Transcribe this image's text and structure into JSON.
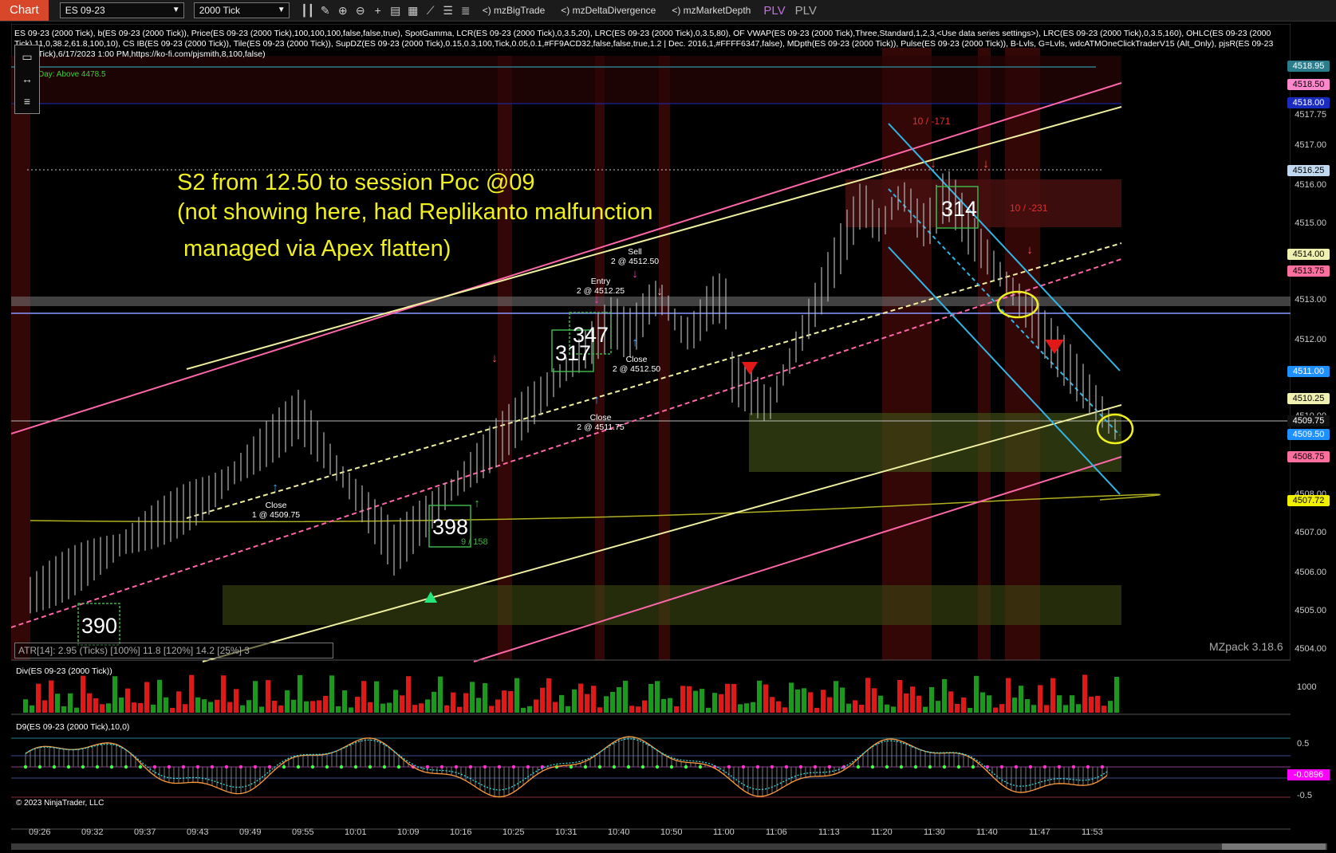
{
  "toolbar": {
    "chart_tab": "Chart",
    "instrument": "ES 09-23",
    "interval": "2000 Tick",
    "links": [
      "<) mzBigTrade",
      "<) mzDeltaDivergence",
      "<) mzMarketDepth"
    ],
    "plv_a": "PLV",
    "plv_b": "PLV"
  },
  "indicator_header": "ES 09-23 (2000 Tick), b(ES 09-23 (2000 Tick)), Price(ES 09-23 (2000 Tick),100,100,100,false,false,true), SpotGamma, LCR(ES 09-23 (2000 Tick),0,3.5,20), LRC(ES 09-23 (2000 Tick),0,3.5,80), OF VWAP(ES 09-23 (2000 Tick),Three,Standard,1,2,3,<Use data series settings>), LRC(ES 09-23 (2000 Tick),0,3.5,160), OHLC(ES 09-23 (2000 Tick),11,0,38.2,61.8,100,10), CS IB(ES 09-23 (2000 Tick)), Tile(ES 09-23 (2000 Tick)), SupDZ(ES 09-23 (2000 Tick),0.15,0.3,100,Tick,0.05,0.1,#FF9ACD32,false,false,true,1.2 | Dec. 2016,1,#FFFF6347,false), MDpth(ES 09-23 (2000 Tick)), Pulse(ES 09-23 (2000 Tick)), B-Lvls, G=Lvls, wdcATMOneClickTraderV15 (Alt_Only), pjsR(ES 09-23 (2000 Tick),6/17/2023 1:00 PM,https://ko-fi.com/pjsmith,8,100,false)",
  "day_label": "Day: Above 4478.5",
  "note_lines": [
    "S2 from 12.50 to session Poc @09",
    "(not showing here, had Replikanto malfunction",
    " managed via Apex flatten)"
  ],
  "trade_labels": {
    "sell": [
      "Sell",
      "2 @ 4512.50"
    ],
    "entry": [
      "Entry",
      "2 @ 4512.25"
    ],
    "close1": [
      "Close",
      "2 @ 4512.50"
    ],
    "close2": [
      "Close",
      "2 @ 4511.75"
    ],
    "close3": [
      "Close",
      "1 @ 4509.75"
    ]
  },
  "box_numbers": [
    "314",
    "347",
    "317",
    "398",
    "390"
  ],
  "small_green": "9 / 158",
  "red_labels": [
    "10 / -171",
    "10 / -231"
  ],
  "price_axis": [
    "4517.75",
    "4517.00",
    "4516.00",
    "4515.00",
    "4513.00",
    "4512.00",
    "4510.00",
    "4508.00",
    "4507.00",
    "4506.00",
    "4505.00",
    "4504.00"
  ],
  "price_tags": [
    {
      "label": "4518.95",
      "bg": "#2a7d8c",
      "fg": "#ffffff"
    },
    {
      "label": "4518.50",
      "bg": "#ff88cc",
      "fg": "#000000"
    },
    {
      "label": "4518.00",
      "bg": "#1a2bbf",
      "fg": "#ffffff"
    },
    {
      "label": "4516.25",
      "bg": "#c0d8f0",
      "fg": "#000000"
    },
    {
      "label": "4514.00",
      "bg": "#f0f0b0",
      "fg": "#000000"
    },
    {
      "label": "4513.75",
      "bg": "#ff6fa0",
      "fg": "#000000"
    },
    {
      "label": "4511.00",
      "bg": "#1e90ff",
      "fg": "#ffffff"
    },
    {
      "label": "4510.25",
      "bg": "#f0f0b0",
      "fg": "#000000"
    },
    {
      "label": "4509.75",
      "bg": "#111111",
      "fg": "#ffffff"
    },
    {
      "label": "4509.50",
      "bg": "#1e90ff",
      "fg": "#ffffff"
    },
    {
      "label": "4508.75",
      "bg": "#ff6fa0",
      "fg": "#000000"
    },
    {
      "label": "4507.72",
      "bg": "#f0f000",
      "fg": "#000000"
    }
  ],
  "time_axis": [
    "09:26",
    "09:32",
    "09:37",
    "09:43",
    "09:49",
    "09:55",
    "10:01",
    "10:09",
    "10:16",
    "10:25",
    "10:31",
    "10:40",
    "10:50",
    "11:00",
    "11:06",
    "11:13",
    "11:20",
    "11:30",
    "11:40",
    "11:47",
    "11:53"
  ],
  "atr_text": "ATR[14]: 2.95 (Ticks) [100%] 11.8  [120%] 14.2  [25%] 3",
  "watermark": "MZpack 3.18.6",
  "div_pane": {
    "title": "Div(ES 09-23 (2000 Tick))",
    "axis": "1000"
  },
  "d9_pane": {
    "title": "D9(ES 09-23 (2000 Tick),10,0)",
    "axis_top": "0.5",
    "axis_bot": "-0.5",
    "tag": "-0.0896",
    "tag_bg": "#ff00ff"
  },
  "copyright": "© 2023 NinjaTrader, LLC",
  "colors": {
    "pink": "#ff66aa",
    "yellow": "#f0f0a0",
    "cyan": "#33b5e5",
    "green_zone": "#3c4a14",
    "red_zone": "#5a0f0f"
  }
}
